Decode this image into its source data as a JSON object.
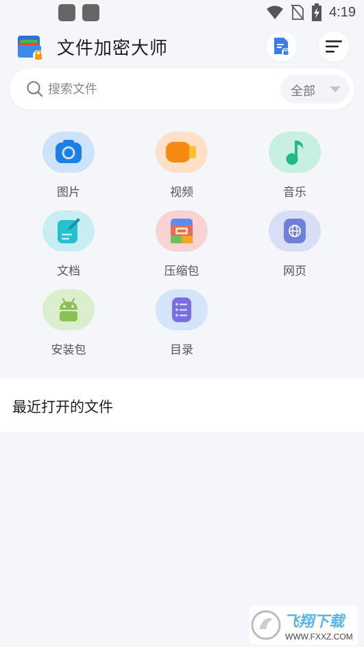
{
  "status_bar": {
    "time": "4:19",
    "icons": [
      "notification-square-icon",
      "notification-square-icon",
      "wifi-icon",
      "no-sim-icon",
      "battery-charging-icon"
    ]
  },
  "header": {
    "title": "文件加密大师",
    "logo_icon": "folder-lock-icon",
    "lock_button_icon": "file-lock-icon",
    "menu_button_icon": "menu-icon"
  },
  "search": {
    "placeholder": "搜索文件",
    "value": "",
    "filter_selected": "全部"
  },
  "categories": [
    {
      "label": "图片",
      "icon": "camera-icon",
      "bg": "#cde3fb",
      "color": "#1b7fe6"
    },
    {
      "label": "视频",
      "icon": "video-icon",
      "bg": "#fde0c5",
      "color": "#f58a12"
    },
    {
      "label": "音乐",
      "icon": "music-note-icon",
      "bg": "#c7f0e1",
      "color": "#22b98a"
    },
    {
      "label": "文档",
      "icon": "document-edit-icon",
      "bg": "#c8eef4",
      "color": "#27bfd1"
    },
    {
      "label": "压缩包",
      "icon": "archive-icon",
      "bg": "#f9d3d3",
      "color": "#e26d5c"
    },
    {
      "label": "网页",
      "icon": "web-page-icon",
      "bg": "#d8def6",
      "color": "#6f7fda"
    },
    {
      "label": "安装包",
      "icon": "android-icon",
      "bg": "#dbeecd",
      "color": "#8cc152"
    },
    {
      "label": "目录",
      "icon": "list-icon",
      "bg": "#d4e4fa",
      "color": "#7a6ee0"
    }
  ],
  "recent": {
    "title": "最近打开的文件"
  },
  "watermark": {
    "text": "飞翔下载",
    "url": "WWW.FXXZ.COM"
  },
  "colors": {
    "background": "#f5f6fa",
    "accent": "#3d7be8"
  }
}
